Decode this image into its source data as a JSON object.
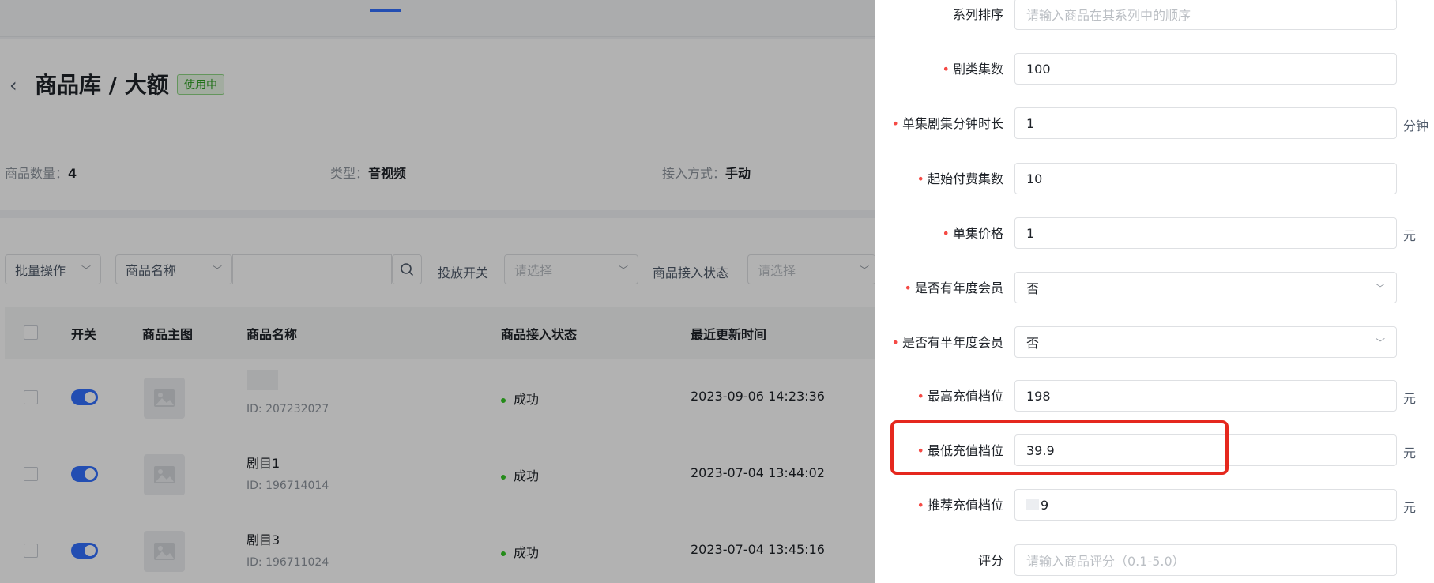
{
  "header": {
    "title": "商品库 / 大额",
    "status_badge": "使用中",
    "meta": [
      {
        "label": "商品数量：",
        "value": "4"
      },
      {
        "label": "类型：",
        "value": "音视频"
      },
      {
        "label": "接入方式：",
        "value": "手动"
      }
    ]
  },
  "filters": {
    "batch_label": "批量操作",
    "field_select": "商品名称",
    "switch_label": "投放开关",
    "switch_placeholder": "请选择",
    "access_label": "商品接入状态",
    "access_placeholder": "请选择"
  },
  "table": {
    "columns": [
      "开关",
      "商品主图",
      "商品名称",
      "商品接入状态",
      "最近更新时间"
    ],
    "rows": [
      {
        "name": "",
        "id": "ID: 207232027",
        "status": "成功",
        "updated": "2023-09-06 14:23:36"
      },
      {
        "name": "剧目1",
        "id": "ID: 196714014",
        "status": "成功",
        "updated": "2023-07-04 13:44:02"
      },
      {
        "name": "剧目3",
        "id": "ID: 196711024",
        "status": "成功",
        "updated": "2023-07-04 13:45:16"
      }
    ]
  },
  "form": {
    "fields": [
      {
        "label": "系列排序",
        "required": false,
        "value": "",
        "placeholder": "请输入商品在其系列中的顺序",
        "unit": ""
      },
      {
        "label": "剧类集数",
        "required": true,
        "value": "100",
        "placeholder": "",
        "unit": ""
      },
      {
        "label": "单集剧集分钟时长",
        "required": true,
        "value": "1",
        "placeholder": "",
        "unit": "分钟"
      },
      {
        "label": "起始付费集数",
        "required": true,
        "value": "10",
        "placeholder": "",
        "unit": ""
      },
      {
        "label": "单集价格",
        "required": true,
        "value": "1",
        "placeholder": "",
        "unit": "元"
      },
      {
        "label": "是否有年度会员",
        "required": true,
        "value": "否",
        "placeholder": "",
        "unit": "",
        "select": true
      },
      {
        "label": "是否有半年度会员",
        "required": true,
        "value": "否",
        "placeholder": "",
        "unit": "",
        "select": true
      },
      {
        "label": "最高充值档位",
        "required": true,
        "value": "198",
        "placeholder": "",
        "unit": "元"
      },
      {
        "label": "最低充值档位",
        "required": true,
        "value": "39.9",
        "placeholder": "",
        "unit": "元"
      },
      {
        "label": "推荐充值档位",
        "required": true,
        "value": "9",
        "placeholder": "",
        "unit": "元"
      },
      {
        "label": "评分",
        "required": false,
        "value": "",
        "placeholder": "请输入商品评分（0.1-5.0）",
        "unit": ""
      }
    ]
  }
}
